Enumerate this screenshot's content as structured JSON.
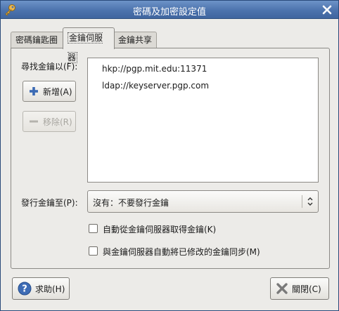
{
  "window": {
    "title": "密碼及加密設定值"
  },
  "tabs": [
    {
      "label": "密碼鑰匙圈"
    },
    {
      "label": "金鑰伺服器"
    },
    {
      "label": "金鑰共享"
    }
  ],
  "keyservers": {
    "find_label": "尋找金鑰以(F):",
    "add_label": "新增(A)",
    "remove_label": "移除(R)",
    "items": [
      "hkp://pgp.mit.edu:11371",
      "ldap://keyserver.pgp.com"
    ]
  },
  "publish": {
    "label": "發行金鑰至(P):",
    "selected": "沒有：不要發行金鑰"
  },
  "options": {
    "auto_retrieve": {
      "label": "自動從金鑰伺服器取得金鑰(K)",
      "checked": false
    },
    "auto_sync": {
      "label": "與金鑰伺服器自動將已修改的金鑰同步(M)",
      "checked": false
    }
  },
  "footer": {
    "help_label": "求助(H)",
    "close_label": "關閉(C)"
  },
  "icons": {
    "app": "key-icon",
    "close": "close-icon",
    "add": "plus-icon",
    "remove": "minus-icon",
    "help": "help-icon",
    "dialog_close": "x-icon"
  }
}
